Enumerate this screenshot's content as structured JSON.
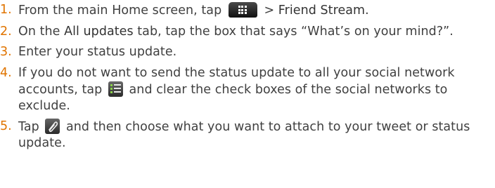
{
  "steps": [
    {
      "number": "1.",
      "text_before": "From the main Home screen, tap ",
      "icon": "all-apps-icon",
      "text_mid": " > ",
      "emph": "Friend Stream",
      "text_after": "."
    },
    {
      "number": "2.",
      "text_before": "On the ",
      "emph": "All updates",
      "text_after": " tab, tap the box that says “What’s on your mind?”."
    },
    {
      "number": "3.",
      "text": "Enter your status update."
    },
    {
      "number": "4.",
      "text_before": "If you do not want to send the status update to all your social network accounts, tap ",
      "icon": "network-selection-icon",
      "text_after": " and clear the check boxes of the social networks to exclude."
    },
    {
      "number": "5.",
      "text_before": "Tap ",
      "icon": "attach-icon",
      "text_after": " and then choose what you want to attach to your tweet or status update."
    }
  ],
  "colors": {
    "number": "#e07400",
    "body_text": "#404040",
    "emphasis_text": "#333333"
  }
}
